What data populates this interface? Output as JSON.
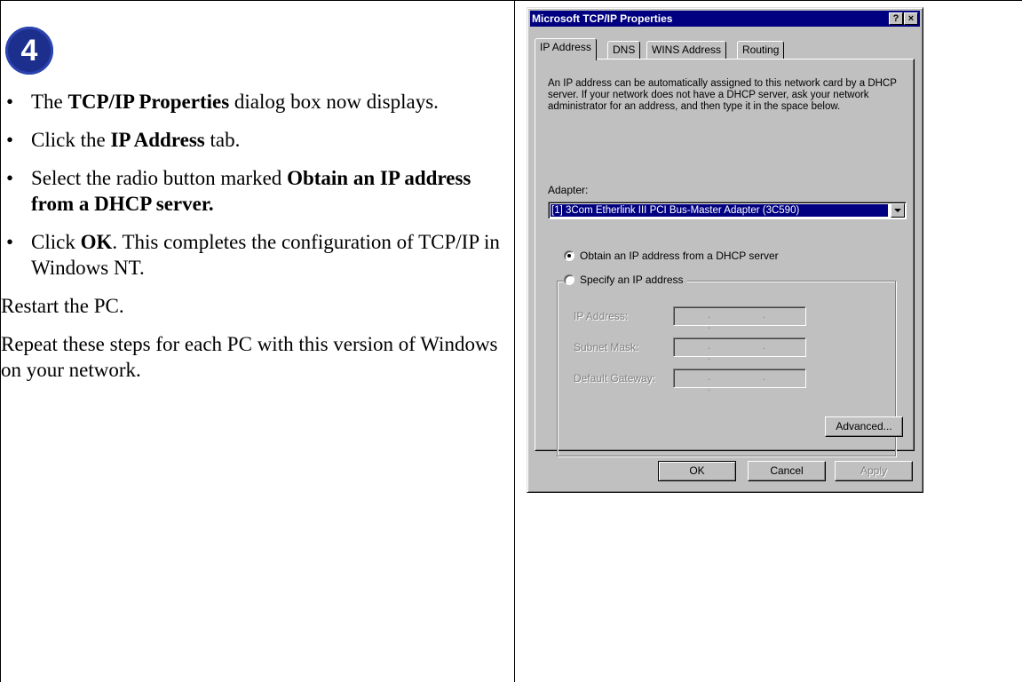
{
  "step": {
    "number": "4"
  },
  "instructions": {
    "bullets": [
      {
        "pre": "The ",
        "bold": "TCP/IP Properties",
        "post": " dialog box now displays."
      },
      {
        "pre": "Click the ",
        "bold": "IP Address",
        "post": " tab."
      },
      {
        "pre": "Select the radio button marked ",
        "bold": "Obtain an IP address from a DHCP server.",
        "post": ""
      },
      {
        "pre": "Click ",
        "bold": "OK",
        "post": ".  This completes the configuration of TCP/IP in Windows NT."
      }
    ],
    "restart": "Restart the PC.",
    "repeat": "Repeat these steps for each PC with this version of Windows on your network."
  },
  "dialog": {
    "title": "Microsoft TCP/IP Properties",
    "help_button": "?",
    "close_button": "×",
    "tabs": [
      "IP Address",
      "DNS",
      "WINS Address",
      "Routing"
    ],
    "active_tab": "IP Address",
    "description": "An IP address can be automatically assigned to this network card by a DHCP server.  If your network does not have a DHCP server, ask your network administrator for an address, and then type it in the space below.",
    "adapter_label": "Adapter:",
    "adapter_value": "[1] 3Com Etherlink III PCI Bus-Master Adapter (3C590)",
    "radio_obtain": "Obtain an IP address from a DHCP server",
    "radio_specify": "Specify an IP address",
    "selected_option": "obtain",
    "fields": [
      "IP Address:",
      "Subnet Mask:",
      "Default Gateway:"
    ],
    "field_dots": ". . .",
    "buttons": {
      "advanced": "Advanced...",
      "ok": "OK",
      "cancel": "Cancel",
      "apply": "Apply"
    }
  }
}
